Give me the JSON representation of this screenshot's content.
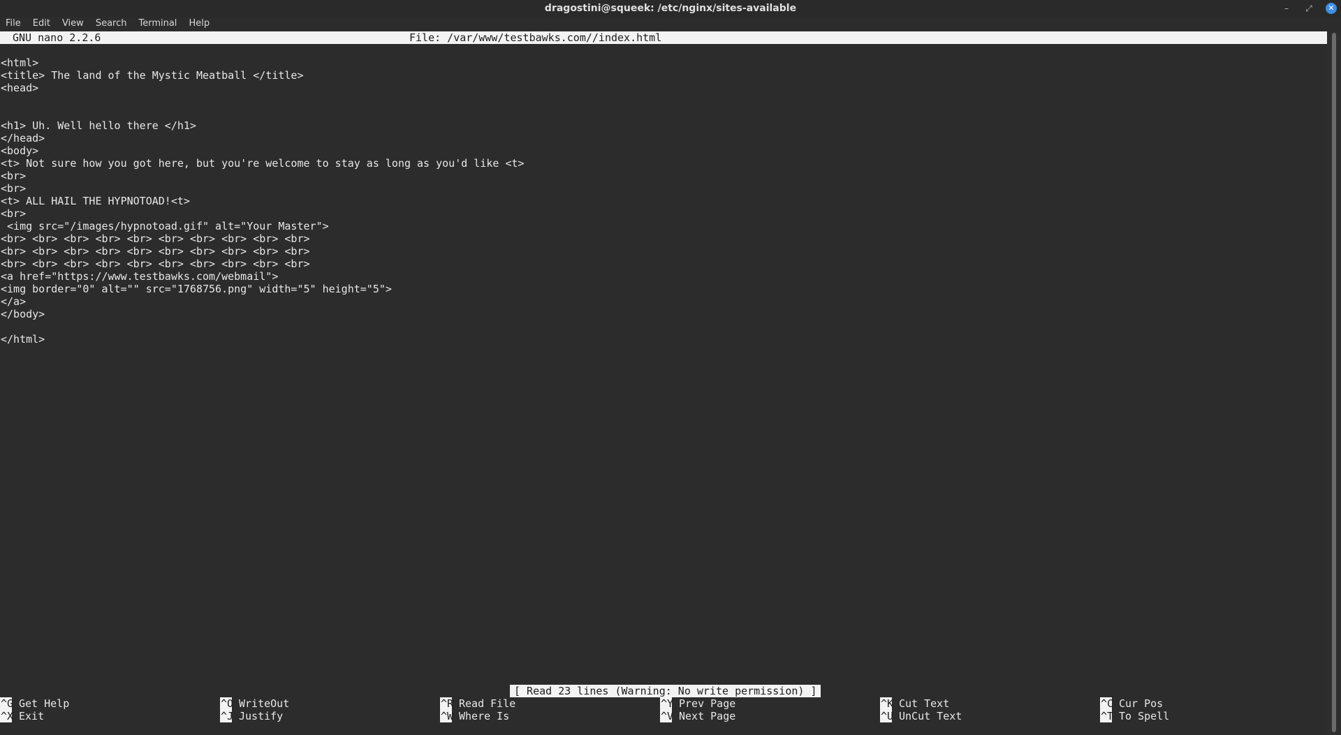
{
  "window": {
    "title": "dragostini@squeek: /etc/nginx/sites-available",
    "minimize_glyph": "–",
    "maximize_glyph": "⤢",
    "close_glyph": "✕"
  },
  "menu": [
    "File",
    "Edit",
    "View",
    "Search",
    "Terminal",
    "Help"
  ],
  "nano": {
    "version": "GNU nano 2.2.6",
    "file_label": "File: /var/www/testbawks.com//index.html"
  },
  "editor": {
    "lines": [
      "",
      "<html>",
      "<title> The land of the Mystic Meatball </title>",
      "<head>",
      "",
      "",
      "<h1> Uh. Well hello there </h1>",
      "</head>",
      "<body>",
      "<t> Not sure how you got here, but you're welcome to stay as long as you'd like <t>",
      "<br>",
      "<br>",
      "<t> ALL HAIL THE HYPNOTOAD!<t>",
      "<br>",
      " <img src=\"/images/hypnotoad.gif\" alt=\"Your Master\">",
      "<br> <br> <br> <br> <br> <br> <br> <br> <br> <br>",
      "<br> <br> <br> <br> <br> <br> <br> <br> <br> <br>",
      "<br> <br> <br> <br> <br> <br> <br> <br> <br> <br>",
      "<a href=\"https://www.testbawks.com/webmail\">",
      "<img border=\"0\" alt=\"\" src=\"1768756.png\" width=\"5\" height=\"5\">",
      "</a>",
      "</body>",
      "",
      "</html>"
    ]
  },
  "status": "[ Read 23 lines (Warning: No write permission) ]",
  "shortcuts": [
    {
      "key": "^G",
      "label": "Get Help"
    },
    {
      "key": "^X",
      "label": "Exit"
    },
    {
      "key": "^O",
      "label": "WriteOut"
    },
    {
      "key": "^J",
      "label": "Justify"
    },
    {
      "key": "^R",
      "label": "Read File"
    },
    {
      "key": "^W",
      "label": "Where Is"
    },
    {
      "key": "^Y",
      "label": "Prev Page"
    },
    {
      "key": "^V",
      "label": "Next Page"
    },
    {
      "key": "^K",
      "label": "Cut Text"
    },
    {
      "key": "^U",
      "label": "UnCut Text"
    },
    {
      "key": "^C",
      "label": "Cur Pos"
    },
    {
      "key": "^T",
      "label": "To Spell"
    }
  ]
}
